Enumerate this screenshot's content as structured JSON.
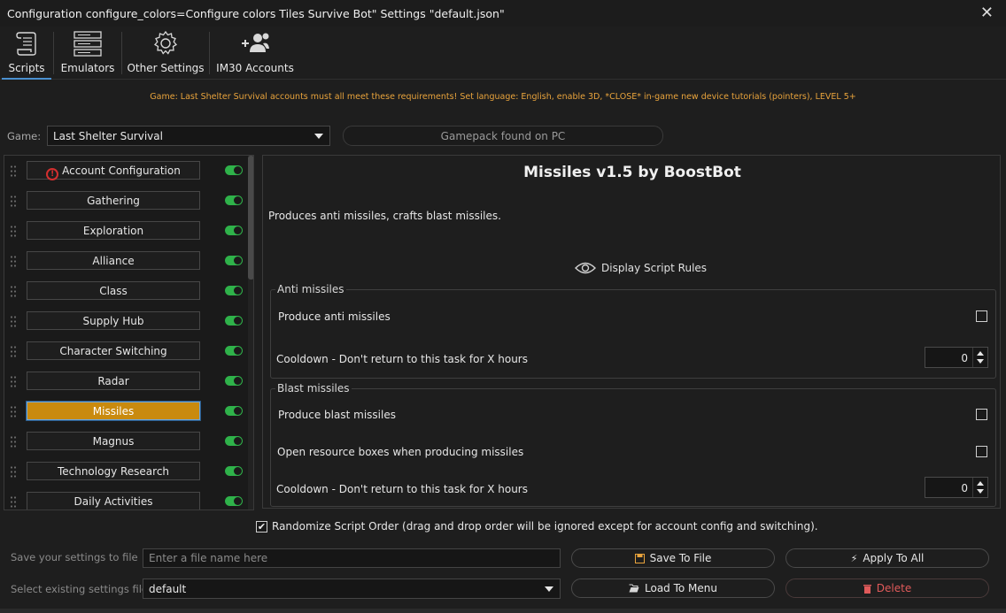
{
  "window": {
    "title": "Configuration configure_colors=Configure colors Tiles Survive Bot\" Settings \"default.json\"",
    "close_glyph": "✕"
  },
  "toolbar": {
    "tabs": [
      {
        "label": "Scripts",
        "icon": "scroll-icon",
        "active": true
      },
      {
        "label": "Emulators",
        "icon": "server-icon",
        "active": false
      },
      {
        "label": "Other Settings",
        "icon": "gear-icon",
        "active": false
      },
      {
        "label": "IM30 Accounts",
        "icon": "users-add-icon",
        "active": false
      }
    ]
  },
  "notice": "Game: Last Shelter Survival accounts must all meet these requirements! Set language: English, enable 3D, *CLOSE* in-game new device tutorials (pointers), LEVEL 5+",
  "game": {
    "label": "Game:",
    "selected": "Last Shelter Survival",
    "gamepack_status": "Gamepack found on PC"
  },
  "scripts": [
    {
      "label": "Account Configuration",
      "warning": true,
      "enabled": true,
      "selected": false
    },
    {
      "label": "Gathering",
      "warning": false,
      "enabled": true,
      "selected": false
    },
    {
      "label": "Exploration",
      "warning": false,
      "enabled": true,
      "selected": false
    },
    {
      "label": "Alliance",
      "warning": false,
      "enabled": true,
      "selected": false
    },
    {
      "label": "Class",
      "warning": false,
      "enabled": true,
      "selected": false
    },
    {
      "label": "Supply Hub",
      "warning": false,
      "enabled": true,
      "selected": false
    },
    {
      "label": "Character Switching",
      "warning": false,
      "enabled": true,
      "selected": false
    },
    {
      "label": "Radar",
      "warning": false,
      "enabled": true,
      "selected": false
    },
    {
      "label": "Missiles",
      "warning": false,
      "enabled": true,
      "selected": true
    },
    {
      "label": "Magnus",
      "warning": false,
      "enabled": true,
      "selected": false
    },
    {
      "label": "Technology Research",
      "warning": false,
      "enabled": true,
      "selected": false
    },
    {
      "label": "Daily Activities",
      "warning": false,
      "enabled": true,
      "selected": false
    }
  ],
  "details": {
    "title": "Missiles v1.5 by BoostBot",
    "description": "Produces anti missiles, crafts blast missiles.",
    "rules_label": "Display Script Rules",
    "anti": {
      "title": "Anti missiles",
      "produce_label": "Produce anti missiles",
      "produce_checked": false,
      "cooldown_label": "Cooldown - Don't return to this task for X hours",
      "cooldown_value": "0"
    },
    "blast": {
      "title": "Blast missiles",
      "produce_label": "Produce blast missiles",
      "produce_checked": false,
      "open_boxes_label": "Open resource boxes when producing missiles",
      "open_boxes_checked": false,
      "cooldown_label": "Cooldown - Don't return to this task for X hours",
      "cooldown_value": "0"
    }
  },
  "randomize": {
    "label": "Randomize Script Order (drag and drop order will be ignored except for account config and switching).",
    "checked": true,
    "check_glyph": "✔"
  },
  "footer": {
    "save_label": "Save your settings to file",
    "filename_placeholder": "Enter a file name here",
    "save_button": "Save To File",
    "apply_button": "Apply To All",
    "select_label": "Select existing settings file",
    "selected_file": "default",
    "load_button": "Load To Menu",
    "delete_button": "Delete"
  },
  "colors": {
    "accent_selected": "#c98a0e",
    "toggle_on": "#2fb24a",
    "notice": "#e8a33c",
    "danger": "#e05a5a",
    "active_tab": "#4a90d0"
  }
}
